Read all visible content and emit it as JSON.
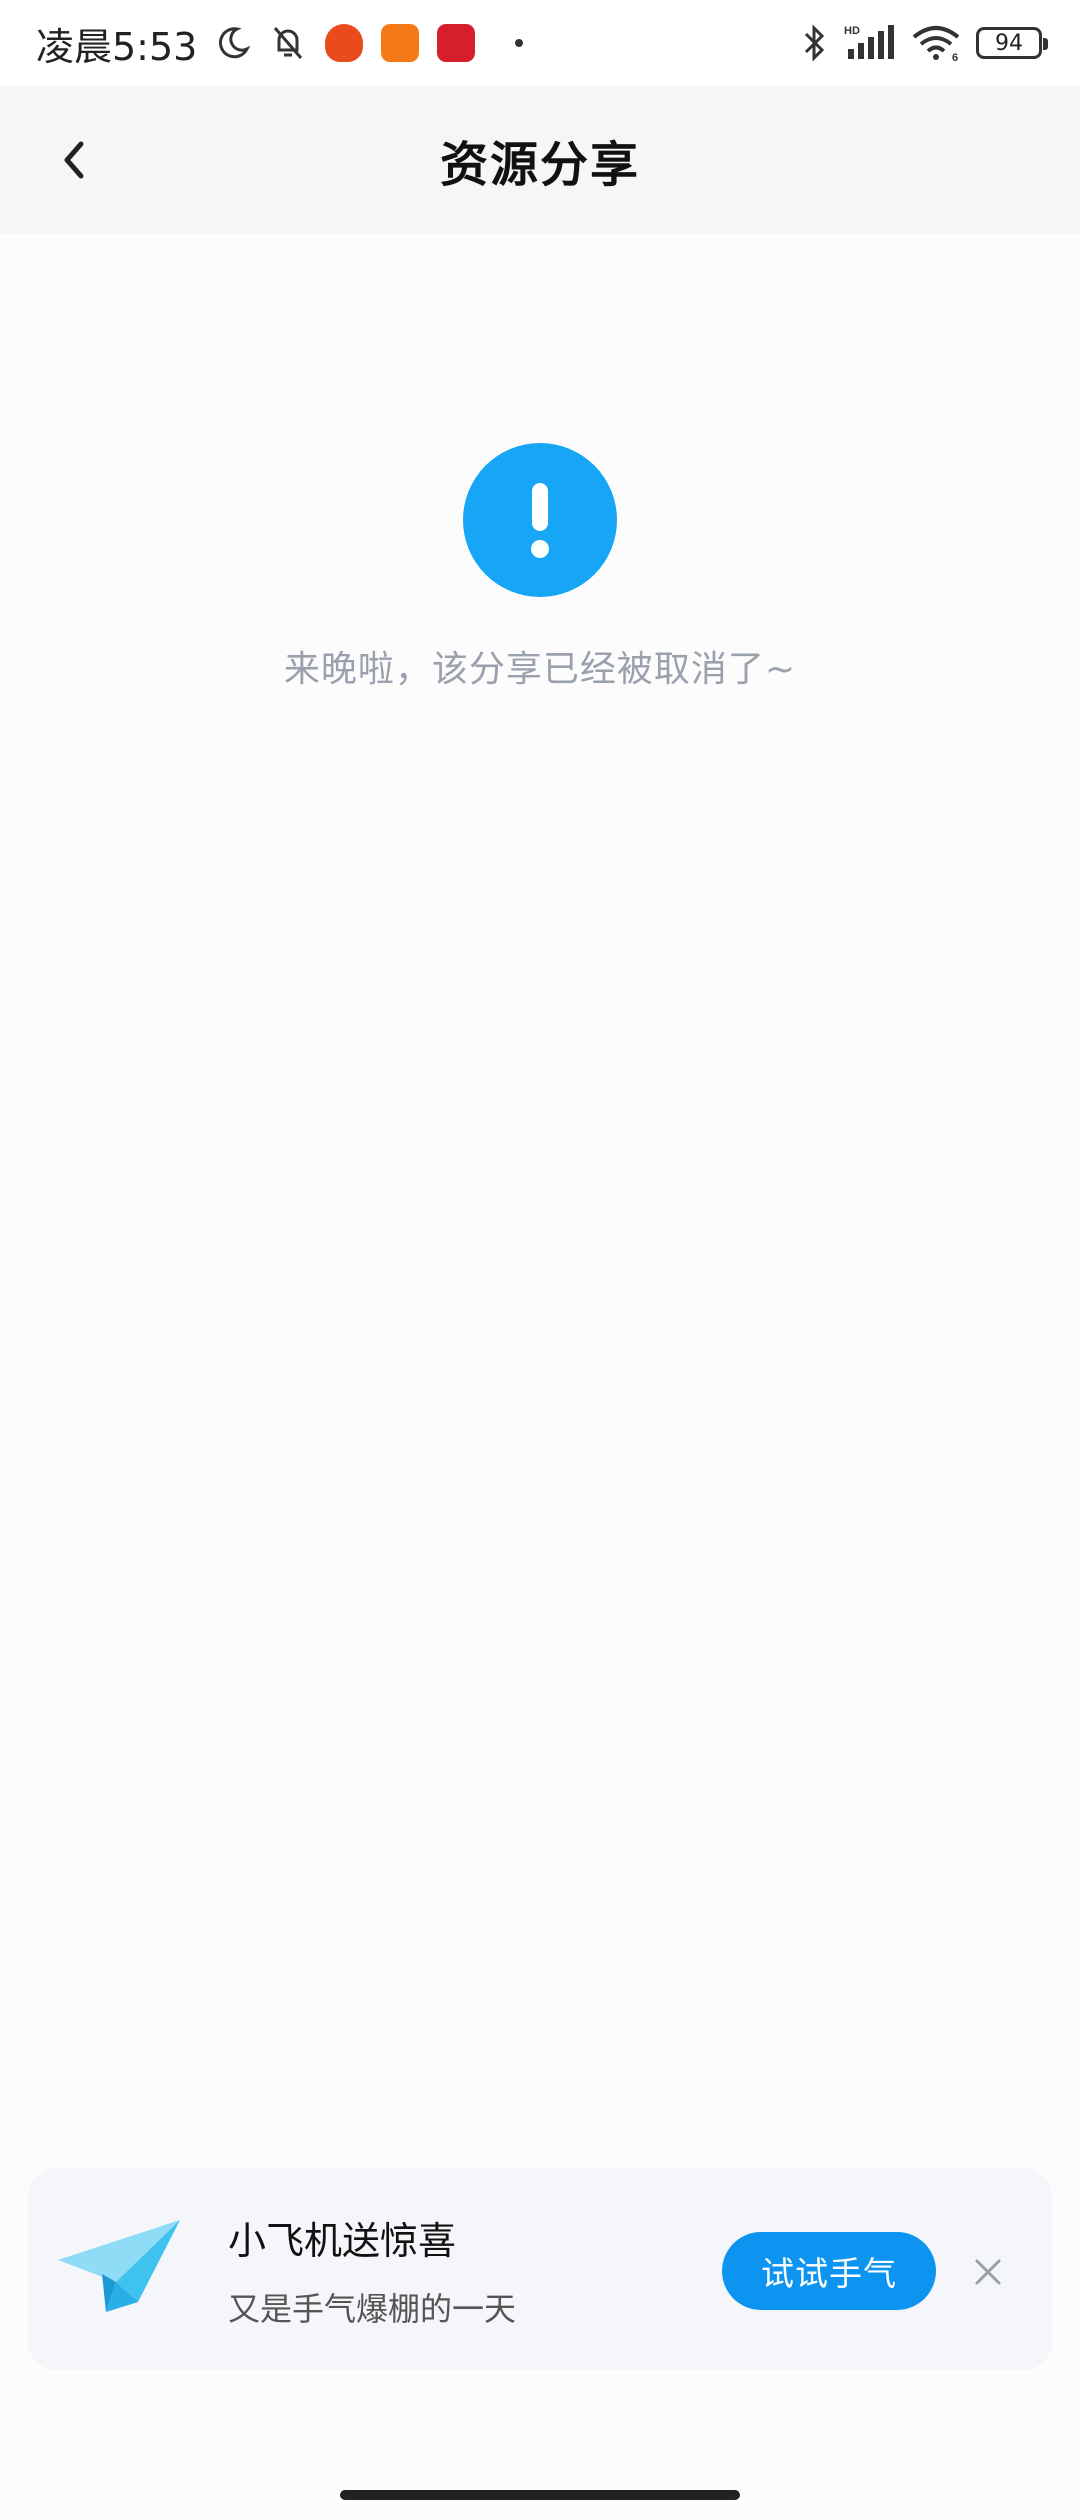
{
  "status_bar": {
    "time": "凌晨5:53",
    "battery": "94",
    "icons": [
      "moon-icon",
      "bell-off-icon",
      "pumpkin-app-icon",
      "orange-app-icon",
      "red-app-icon",
      "bluetooth-icon",
      "signal-icon",
      "wifi-icon",
      "battery-icon"
    ],
    "signal_label": "HD",
    "wifi_label": "6"
  },
  "nav": {
    "title": "资源分享",
    "back_icon": "chevron-left-icon"
  },
  "error_state": {
    "icon": "exclamation-circle-icon",
    "icon_color": "#17a5f5",
    "message": "来晚啦，该分享已经被取消了~"
  },
  "promo": {
    "icon": "paper-plane-icon",
    "title": "小飞机送惊喜",
    "subtitle": "又是手气爆棚的一天",
    "button_label": "试试手气",
    "button_color": "#0c94f0",
    "close_icon": "close-icon"
  }
}
